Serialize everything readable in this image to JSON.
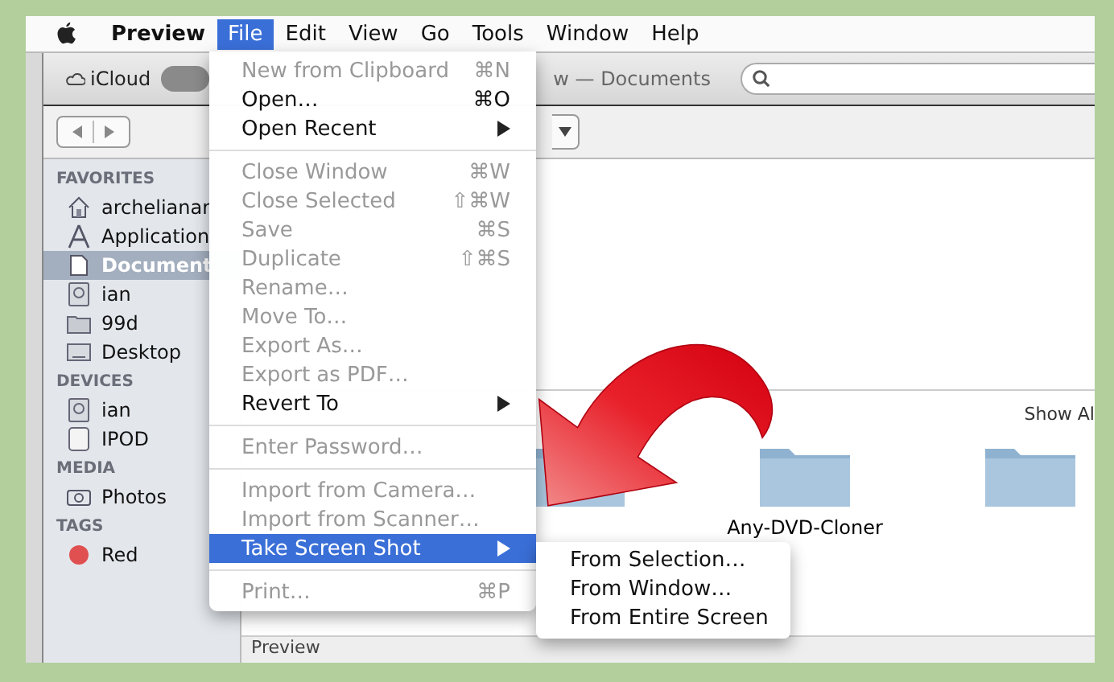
{
  "menu_bar": [
    {
      "label": "Preview",
      "bold": true,
      "selected": false
    },
    {
      "label": "File",
      "bold": false,
      "selected": true
    },
    {
      "label": "Edit",
      "bold": false,
      "selected": false
    },
    {
      "label": "View",
      "bold": false,
      "selected": false
    },
    {
      "label": "Go",
      "bold": false,
      "selected": false
    },
    {
      "label": "Tools",
      "bold": false,
      "selected": false
    },
    {
      "label": "Window",
      "bold": false,
      "selected": false
    },
    {
      "label": "Help",
      "bold": false,
      "selected": false
    }
  ],
  "toolbar": {
    "cloud_label": "iCloud",
    "title": "w — Documents"
  },
  "sidebar": [
    {
      "heading": "FAVORITES",
      "items": [
        {
          "label": "archelianar",
          "kind": "home",
          "selected": false
        },
        {
          "label": "Application",
          "kind": "apps",
          "selected": false
        },
        {
          "label": "Document",
          "kind": "doc",
          "selected": true
        },
        {
          "label": "ian",
          "kind": "drive",
          "selected": false
        },
        {
          "label": "99d",
          "kind": "folder",
          "selected": false
        },
        {
          "label": "Desktop",
          "kind": "desktop",
          "selected": false
        }
      ]
    },
    {
      "heading": "DEVICES",
      "items": [
        {
          "label": "ian",
          "kind": "drive",
          "selected": false
        },
        {
          "label": "IPOD",
          "kind": "ipod",
          "selected": false
        }
      ]
    },
    {
      "heading": "MEDIA",
      "items": [
        {
          "label": "Photos",
          "kind": "camera",
          "selected": false
        }
      ]
    },
    {
      "heading": "TAGS",
      "items": [
        {
          "label": "Red",
          "kind": "tag",
          "color": "#e05050",
          "selected": false
        }
      ]
    }
  ],
  "content": {
    "show_all": "Show Al",
    "folders": [
      {
        "kind": "folder"
      },
      {
        "kind": "folder",
        "label": "Any-DVD-Cloner"
      },
      {
        "kind": "folder"
      }
    ],
    "bottom_label": "Preview"
  },
  "file_menu": [
    {
      "kind": "item",
      "label": "New from Clipboard",
      "shortcut": "⌘N",
      "disabled": true,
      "submenu": false,
      "selected": false
    },
    {
      "kind": "item",
      "label": "Open…",
      "shortcut": "⌘O",
      "disabled": false,
      "submenu": false,
      "selected": false
    },
    {
      "kind": "item",
      "label": "Open Recent",
      "disabled": false,
      "submenu": true,
      "selected": false
    },
    {
      "kind": "separator"
    },
    {
      "kind": "item",
      "label": "Close Window",
      "shortcut": "⌘W",
      "disabled": true,
      "submenu": false,
      "selected": false
    },
    {
      "kind": "item",
      "label": "Close Selected",
      "shortcut": "⇧⌘W",
      "disabled": true,
      "submenu": false,
      "selected": false
    },
    {
      "kind": "item",
      "label": "Save",
      "shortcut": "⌘S",
      "disabled": true,
      "submenu": false,
      "selected": false
    },
    {
      "kind": "item",
      "label": "Duplicate",
      "shortcut": "⇧⌘S",
      "disabled": true,
      "submenu": false,
      "selected": false
    },
    {
      "kind": "item",
      "label": "Rename…",
      "disabled": true,
      "submenu": false,
      "selected": false
    },
    {
      "kind": "item",
      "label": "Move To…",
      "disabled": true,
      "submenu": false,
      "selected": false
    },
    {
      "kind": "item",
      "label": "Export As…",
      "disabled": true,
      "submenu": false,
      "selected": false
    },
    {
      "kind": "item",
      "label": "Export as PDF…",
      "disabled": true,
      "submenu": false,
      "selected": false
    },
    {
      "kind": "item",
      "label": "Revert To",
      "disabled": false,
      "submenu": true,
      "selected": false
    },
    {
      "kind": "separator"
    },
    {
      "kind": "item",
      "label": "Enter Password…",
      "disabled": true,
      "submenu": false,
      "selected": false
    },
    {
      "kind": "separator"
    },
    {
      "kind": "item",
      "label": "Import from Camera…",
      "disabled": true,
      "submenu": false,
      "selected": false
    },
    {
      "kind": "item",
      "label": "Import from Scanner…",
      "disabled": true,
      "submenu": false,
      "selected": false
    },
    {
      "kind": "item",
      "label": "Take Screen Shot",
      "disabled": false,
      "submenu": true,
      "selected": true
    },
    {
      "kind": "separator"
    },
    {
      "kind": "item",
      "label": "Print…",
      "shortcut": "⌘P",
      "disabled": true,
      "submenu": false,
      "selected": false
    }
  ],
  "submenu": [
    {
      "label": "From Selection…"
    },
    {
      "label": "From Window…"
    },
    {
      "label": "From Entire Screen"
    }
  ]
}
